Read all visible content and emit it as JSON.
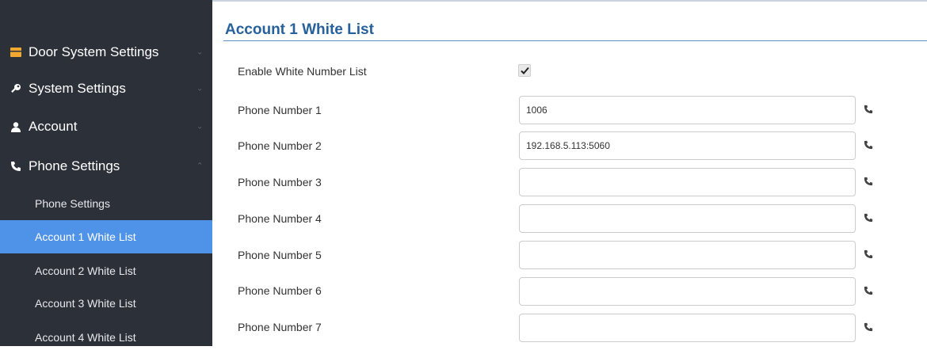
{
  "sidebar": {
    "items": [
      {
        "label": "Door System Settings",
        "icon": "door-icon"
      },
      {
        "label": "System Settings",
        "icon": "key-icon"
      },
      {
        "label": "Account",
        "icon": "user-icon"
      },
      {
        "label": "Phone Settings",
        "icon": "phone-icon"
      }
    ],
    "sub_items": [
      {
        "label": "Phone Settings"
      },
      {
        "label": "Account 1 White List",
        "active": true
      },
      {
        "label": "Account 2 White List"
      },
      {
        "label": "Account 3 White List"
      },
      {
        "label": "Account 4 White List"
      }
    ]
  },
  "main": {
    "title": "Account 1 White List",
    "enable_label": "Enable White Number List",
    "enable_checked": true,
    "phones": [
      {
        "label": "Phone Number 1",
        "value": "1006"
      },
      {
        "label": "Phone Number 2",
        "value": "192.168.5.113:5060"
      },
      {
        "label": "Phone Number 3",
        "value": ""
      },
      {
        "label": "Phone Number 4",
        "value": ""
      },
      {
        "label": "Phone Number 5",
        "value": ""
      },
      {
        "label": "Phone Number 6",
        "value": ""
      },
      {
        "label": "Phone Number 7",
        "value": ""
      }
    ]
  },
  "colors": {
    "sidebar_bg": "#2c3039",
    "active_bg": "#4f93e8",
    "title": "#27619b",
    "door_icon": "#f0a830"
  }
}
